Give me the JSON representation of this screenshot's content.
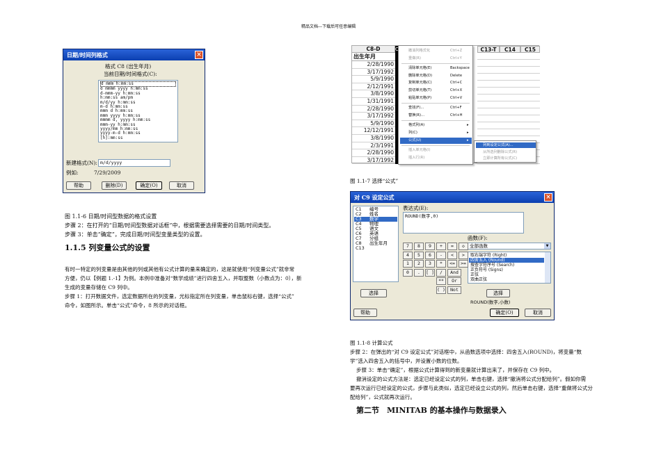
{
  "page_header": "精品文档---下载后可任意编辑",
  "dialog1": {
    "title": "日期/时间列格式",
    "format_label": "格式 C8 (出生年月)",
    "current_label": "当前日期/时间格式(C):",
    "formats": [
      "d mmm h:mm:ss",
      "d mmmm yyyy h:mm:ss",
      "d-mmm-yy h:mm:ss",
      "h:mm:ss am/pm",
      "m/d/yy h:mm:ss",
      "m-d h:mm:ss",
      "mmm d h:mm:ss",
      "mmm yyyy h:mm:ss",
      "mmmm d, yyyy h:mm:ss",
      "mmm-yy h:mm:ss",
      "yyyy/mm h:mm:ss",
      "yyyy-m-d h:mm:ss",
      "[h]:mm:ss"
    ],
    "new_format_label": "新建格式(N):",
    "new_format_value": "m/d/yyyy",
    "example_label": "例如:",
    "example_value": "7/29/2009",
    "buttons": [
      "帮助",
      "删除(D)",
      "确定(O)",
      "取消"
    ]
  },
  "left": {
    "caption": "图 1.1-6 日期/时间型数据的格式设置",
    "step2": "步骤 2：在打开的“日期/时间型数据对话框”中，根据需要选择需要的日期/时间类型。",
    "step3": "步骤 3：单击“确定”，完成日期/时间型变量类型的设置。",
    "heading": "1.1.5 列变量公式的设置",
    "para1a": "有时一特定的列变量是由其他的列或其他有公式计算的量来确定的，这是就使用“列变量公式”就非常",
    "para1b": "方便，仍以【例题 1.-1】为例。本例中准备对“数学成绩”进行四舍五入，并取整数（小数点为：0），新",
    "para1c": "生成的变量存储在 C9 列中。",
    "step1a": "步骤 1：打开数据文件，选定数据所在的列变量，光标指定所在列变量，单击鼠标右键，选择“公式”",
    "step1b": "命令，如图所示。单击“公式”命令，8 所示的对话框。"
  },
  "sheet": {
    "col_c8": "C8-D",
    "col_c9": "C9",
    "col_c13": "C13-T",
    "col_c14": "C14",
    "col_c15": "C15",
    "row_header": "出生年月",
    "dates": [
      "2/28/1990",
      "3/17/1992",
      "5/9/1990",
      "2/12/1991",
      "3/8/1990",
      "1/31/1991",
      "2/28/1990",
      "3/17/1992",
      "5/9/1990",
      "12/12/1991",
      "3/8/1990",
      "2/3/1991",
      "2/28/1990",
      "3/17/1992"
    ],
    "menu": [
      {
        "label": "撤消列格式化",
        "key": "Ctrl+Z"
      },
      {
        "label": "重做(R)",
        "key": "Ctrl+Y"
      },
      {
        "label": "清除单元格(E)",
        "key": "Backspace"
      },
      {
        "label": "删除单元格(D)",
        "key": "Delete"
      },
      {
        "label": "复制单元格(C)",
        "key": "Ctrl+C"
      },
      {
        "label": "剪切单元格(T)",
        "key": "Ctrl+X"
      },
      {
        "label": "粘贴单元格(P)",
        "key": "Ctrl+V"
      },
      {
        "label": "查找(F)...",
        "key": "Ctrl+F"
      },
      {
        "label": "替换(R)...",
        "key": "Ctrl+H"
      },
      {
        "label": "格式列(A)",
        "key": ""
      },
      {
        "label": "列(C)",
        "key": ""
      },
      {
        "label": "公式(U)",
        "key": ""
      },
      {
        "label": "插入单元格(I)",
        "key": ""
      },
      {
        "label": "插入行(R)",
        "key": ""
      }
    ],
    "submenu": [
      "列到设定公式(A)...",
      "从所选列删除公式(R)",
      "立即计算所有公式(C)"
    ]
  },
  "caption7": "图 1.1-7 选择“公式”",
  "dialog2": {
    "title": "对 C9 设定公式",
    "columns": [
      "C1",
      "C2",
      "C3",
      "C4",
      "C5",
      "C6",
      "C7",
      "C8",
      "C13"
    ],
    "col_names": [
      "编号",
      "姓名",
      "数学",
      "物理",
      "语文",
      "英语",
      "分组",
      "出生年月",
      ""
    ],
    "expr_label": "表达式(E):",
    "expr_value": "ROUND(数字,0)",
    "keys": [
      "7",
      "8",
      "9",
      "+",
      "=",
      "◇",
      "4",
      "5",
      "6",
      "-",
      "<",
      ">",
      "1",
      "2",
      "3",
      "*",
      "<=",
      ">=",
      "0",
      ".",
      "[ ]",
      "/",
      "And",
      "**",
      "Or",
      "( )",
      "Not"
    ],
    "func_label": "函数(F):",
    "func_select": "全部函数",
    "functions": [
      "取右端字符 (Right)",
      "四舍五入 (Round)",
      "搜查字符序号 (Search)",
      "正负符号 (Signs)",
      "正弦",
      "双曲正弦"
    ],
    "select_left": "选择",
    "select_right": "选择",
    "round_hint": "ROUND(数字,小数)",
    "help": "帮助",
    "ok": "确定(O)",
    "cancel": "取消"
  },
  "right": {
    "caption": "图 1.1-8 计算公式",
    "step2a": "步骤 2：在弹出的“对 C9 设定公式”对话框中，从函数选项中选择：四舍五入(ROUND)，将变量“数",
    "step2b": "学”选入四舍五入的括号中，并设置小数的位数。",
    "step3": "步骤 3：单击“确定”，根据公式计算得到的新变量就计算出来了，并保存在 C9 列中。",
    "cancel_a": "撤消设定的公式方法是：选定已经设定公式的列，单击右键，选择“撤消将公式分配给列”。假如你需",
    "cancel_b": "要再次运行已经设定的公式，步骤与此类似，选定已经设立公式的列，然后单击右键，选择“重做将公式分",
    "cancel_c": "配给列”，公式就再次运行。",
    "section": "第二节　MINITAB 的基本操作与数据录入"
  }
}
